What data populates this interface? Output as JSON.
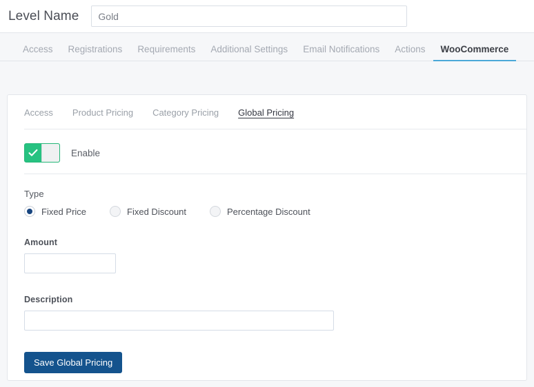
{
  "header": {
    "label": "Level Name",
    "level_name_value": "Gold",
    "level_name_placeholder": ""
  },
  "main_tabs": [
    {
      "label": "Access",
      "active": false
    },
    {
      "label": "Registrations",
      "active": false
    },
    {
      "label": "Requirements",
      "active": false
    },
    {
      "label": "Additional Settings",
      "active": false
    },
    {
      "label": "Email Notifications",
      "active": false
    },
    {
      "label": "Actions",
      "active": false
    },
    {
      "label": "WooCommerce",
      "active": true
    }
  ],
  "sub_tabs": [
    {
      "label": "Access",
      "active": false
    },
    {
      "label": "Product Pricing",
      "active": false
    },
    {
      "label": "Category Pricing",
      "active": false
    },
    {
      "label": "Global Pricing",
      "active": true
    }
  ],
  "enable": {
    "label": "Enable",
    "state": "on",
    "check_icon": "check-icon"
  },
  "type": {
    "label": "Type",
    "options": [
      {
        "label": "Fixed Price",
        "selected": true
      },
      {
        "label": "Fixed Discount",
        "selected": false
      },
      {
        "label": "Percentage Discount",
        "selected": false
      }
    ]
  },
  "amount": {
    "label": "Amount",
    "value": "",
    "placeholder": ""
  },
  "description": {
    "label": "Description",
    "value": "",
    "placeholder": ""
  },
  "save_button": {
    "label": "Save Global Pricing"
  },
  "colors": {
    "toggle_on": "#27c281",
    "active_tab_underline": "#4aa8d8",
    "radio_selected": "#17457f",
    "save_button_bg": "#14538d",
    "page_bg": "#f6f7f9"
  }
}
